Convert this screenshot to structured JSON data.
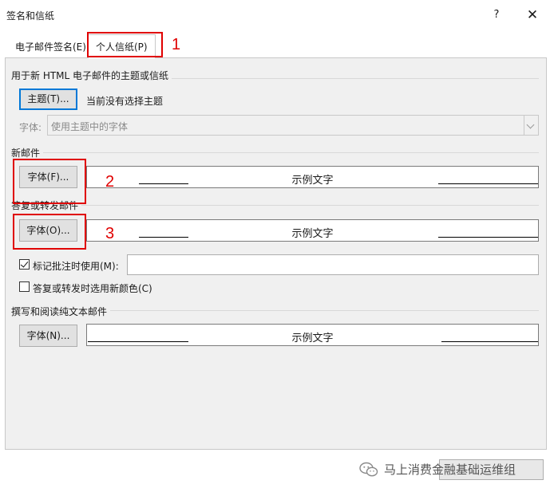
{
  "window": {
    "title": "签名和信纸",
    "help": "?",
    "close": "✕"
  },
  "tabs": [
    {
      "label": "电子邮件签名(E)"
    },
    {
      "label": "个人信纸(P)"
    }
  ],
  "theme_section": {
    "label": "用于新 HTML 电子邮件的主题或信纸",
    "theme_button": "主题(T)...",
    "no_theme_text": "当前没有选择主题",
    "font_label": "字体:",
    "font_combo_value": "使用主题中的字体"
  },
  "new_mail": {
    "label": "新邮件",
    "font_button": "字体(F)...",
    "preview_text": "示例文字"
  },
  "reply": {
    "label": "答复或转发邮件",
    "font_button": "字体(O)...",
    "preview_text": "示例文字",
    "mark_comments_label": "标记批注时使用(M):",
    "mark_comments_checked": true,
    "new_color_label": "答复或转发时选用新颜色(C)",
    "new_color_checked": false
  },
  "plain_text": {
    "label": "撰写和阅读纯文本邮件",
    "font_button": "字体(N)...",
    "preview_text": "示例文字"
  },
  "annotations": [
    "1",
    "2",
    "3"
  ],
  "watermark": {
    "text": "马上消费金融基础运维组",
    "icon": "wechat-icon"
  },
  "colors": {
    "annotation": "#e00000",
    "panel": "#f0f0f0",
    "focus": "#0078d7"
  }
}
